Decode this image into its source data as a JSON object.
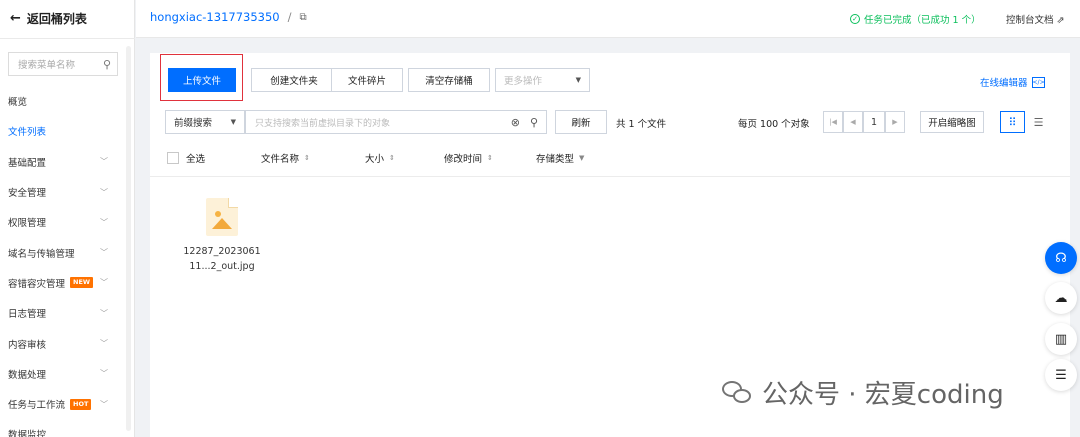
{
  "sidebar": {
    "back_label": "返回桶列表",
    "search_placeholder": "搜索菜单名称",
    "items": [
      {
        "label": "概览",
        "chevron": false,
        "active": false
      },
      {
        "label": "文件列表",
        "chevron": false,
        "active": true
      },
      {
        "label": "基础配置",
        "chevron": true
      },
      {
        "label": "安全管理",
        "chevron": true
      },
      {
        "label": "权限管理",
        "chevron": true
      },
      {
        "label": "域名与传输管理",
        "chevron": true
      },
      {
        "label": "容错容灾管理",
        "chevron": true,
        "tag": "NEW"
      },
      {
        "label": "日志管理",
        "chevron": true
      },
      {
        "label": "内容审核",
        "chevron": true
      },
      {
        "label": "数据处理",
        "chevron": true
      },
      {
        "label": "任务与工作流",
        "chevron": true,
        "tag": "HOT"
      },
      {
        "label": "数据监控",
        "chevron": false
      }
    ]
  },
  "header": {
    "bucket_name": "hongxiac-1317735350",
    "separator": "/",
    "task_status": "任务已完成（已成功 1 个）",
    "console_docs": "控制台文档"
  },
  "toolbar": {
    "upload": "上传文件",
    "create_folder": "创建文件夹",
    "fragments": "文件碎片",
    "clear_bucket": "清空存储桶",
    "more_ops": "更多操作",
    "online_editor": "在线编辑器"
  },
  "search": {
    "mode": "前缀搜索",
    "placeholder": "只支持搜索当前虚拟目录下的对象",
    "refresh": "刷新",
    "total": "共 1 个文件",
    "per_page": "每页 100 个对象",
    "page": "1",
    "thumbnail": "开启缩略图"
  },
  "columns": {
    "select_all": "全选",
    "name": "文件名称",
    "size": "大小",
    "modified": "修改时间",
    "storage": "存储类型"
  },
  "files": [
    {
      "name_line1": "12287_2023061",
      "name_line2": "11...2_out.jpg"
    }
  ],
  "watermark": "公众号 · 宏夏coding",
  "colors": {
    "accent": "#006eff",
    "success": "#0abf5b",
    "highlight": "#e0323c",
    "tag": "#ff7200"
  }
}
